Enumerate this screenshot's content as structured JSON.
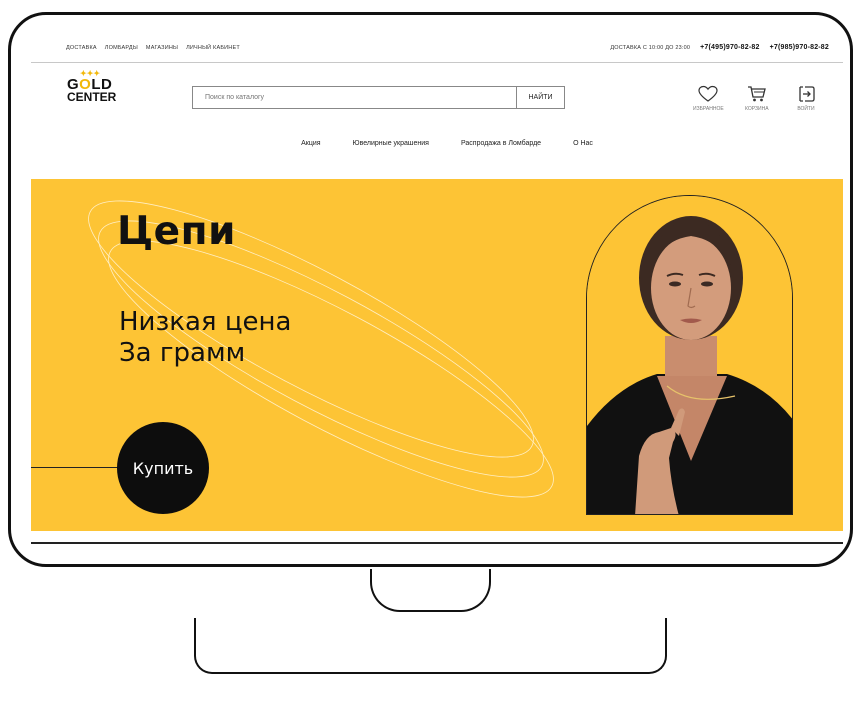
{
  "topbar": {
    "links": [
      "ДОСТАВКА",
      "ЛОМБАРДЫ",
      "МАГАЗИНЫ",
      "ЛИЧНЫЙ КАБИНЕТ"
    ],
    "delivery": "ДОСТАВКА С 10:00 ДО 23:00",
    "phone1": "+7(495)970-82-82",
    "phone2": "+7(985)970-82-82"
  },
  "logo": {
    "line1_a": "G",
    "line1_o": "O",
    "line1_b": "LD",
    "line2": "CENTER"
  },
  "search": {
    "placeholder": "Поиск по каталогу",
    "button": "НАЙТИ"
  },
  "header_icons": {
    "favorites": "ИЗБРАННОЕ",
    "cart": "КОРЗИНА",
    "login": "ВОЙТИ"
  },
  "nav": [
    "Акция",
    "Ювелирные украшения",
    "Распродажа в Ломбарде",
    "О Нас"
  ],
  "hero": {
    "title": "Цепи",
    "subtitle_line1": "Низкая цена",
    "subtitle_line2": "За грамм",
    "button": "Купить"
  },
  "colors": {
    "accent": "#fdc435",
    "dark": "#0d0d0d",
    "logo_gold": "#f2b80a"
  }
}
